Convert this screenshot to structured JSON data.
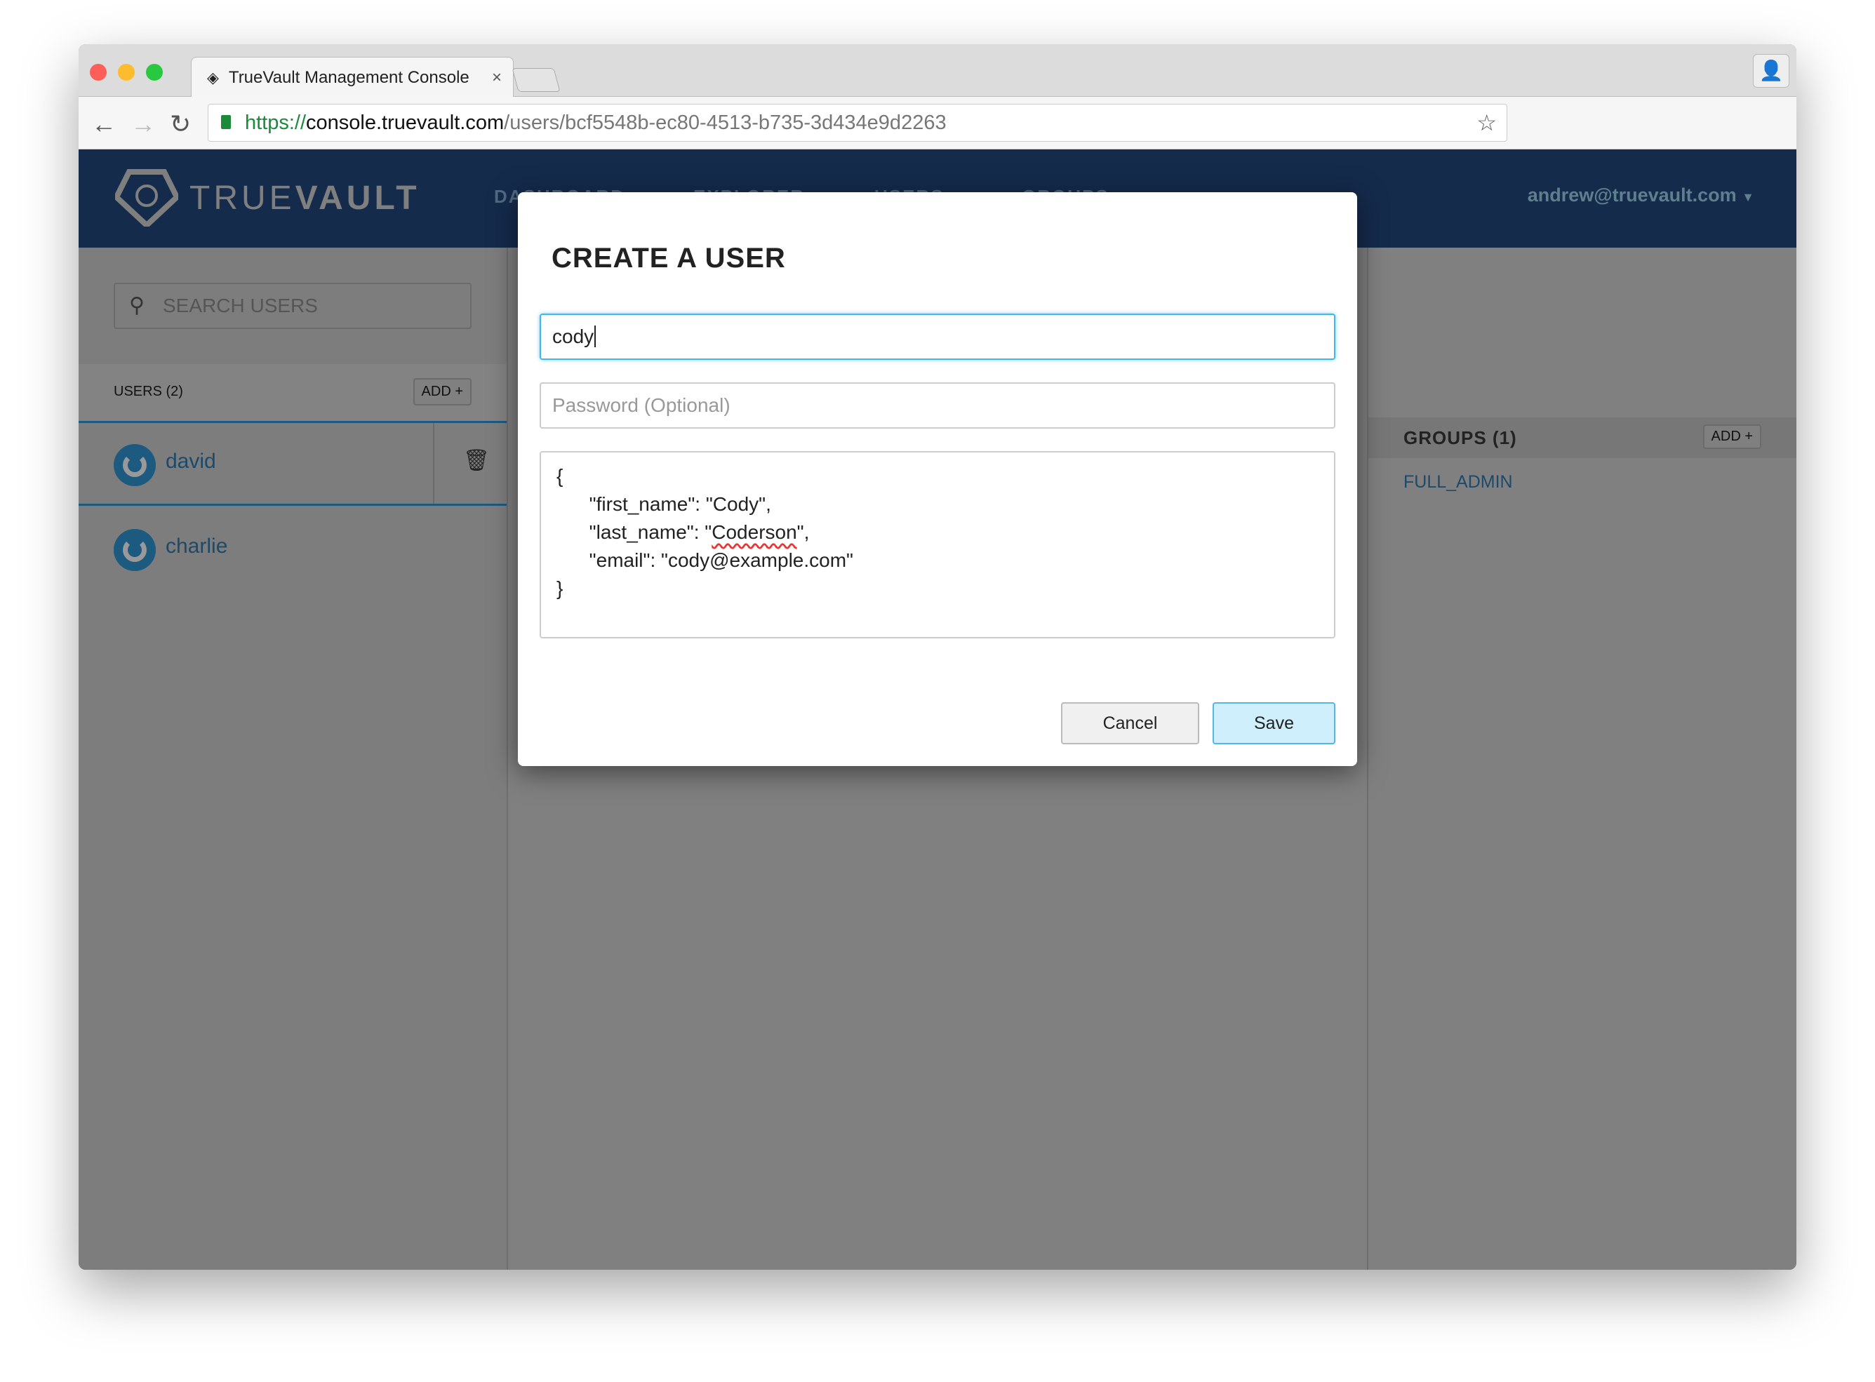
{
  "browser": {
    "tab_title": "TrueVault Management Console",
    "url_scheme": "https://",
    "url_domain": "console.truevault.com",
    "url_path": "/users/bcf5548b-ec80-4513-b735-3d434e9d2263"
  },
  "header": {
    "logo_light": "TRUE",
    "logo_bold": "VAULT",
    "nav": [
      "DASHBOARD",
      "EXPLORER",
      "USERS",
      "GROUPS"
    ],
    "account": "andrew@truevault.com"
  },
  "sidebar": {
    "search_placeholder": "SEARCH USERS",
    "users_label": "USERS (2)",
    "add_label": "ADD +",
    "users": [
      {
        "name": "david"
      },
      {
        "name": "charlie"
      }
    ]
  },
  "groups": {
    "label": "GROUPS (1)",
    "add_label": "ADD +",
    "items": [
      "FULL_ADMIN"
    ]
  },
  "modal": {
    "title": "CREATE A USER",
    "username_value": "cody",
    "password_placeholder": "Password (Optional)",
    "attributes": {
      "open": "{",
      "l1": "      \"first_name\": \"Cody\",",
      "l2a": "      \"last_name\": \"",
      "l2b": "Coderson",
      "l2c": "\",",
      "l3": "      \"email\": \"cody@example.com\"",
      "close": "}"
    },
    "cancel_label": "Cancel",
    "save_label": "Save"
  },
  "colors": {
    "header": "#152b4c",
    "accent": "#3fb7ee",
    "link": "#1d4a6a"
  }
}
